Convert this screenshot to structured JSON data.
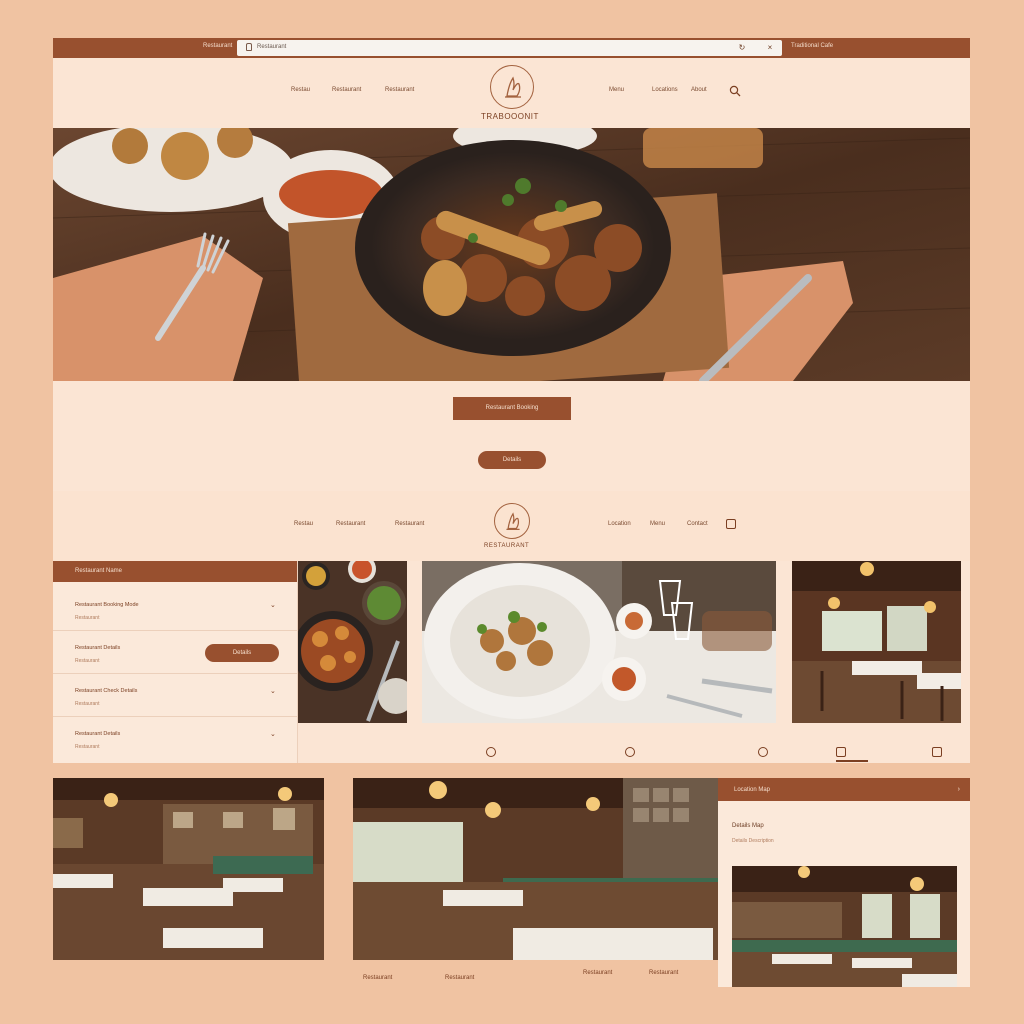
{
  "browser": {
    "left_label": "Restaurant",
    "url": "Restaurant",
    "right_label": "Traditional Cafe"
  },
  "header": {
    "nav_left": [
      "Restau",
      "Restaurant",
      "Restaurant"
    ],
    "nav_right": [
      "Menu",
      "Locations",
      "About"
    ],
    "brand": "TRABOOONIT"
  },
  "hero": {
    "reserve_label": "Restaurant Booking",
    "details_label": "Details"
  },
  "second_header": {
    "nav_left": [
      "Restau",
      "Restaurant",
      "Restaurant"
    ],
    "nav_right": [
      "Location",
      "Menu",
      "Contact"
    ],
    "brand": "RESTAURANT"
  },
  "filters": {
    "title": "Restaurant Name",
    "rows": [
      {
        "label": "Restaurant Booking Mode",
        "sub": "Restaurant"
      },
      {
        "label": "Restaurant Details",
        "sub": "Restaurant"
      },
      {
        "label": "Restaurant Check Details",
        "sub": "Restaurant"
      },
      {
        "label": "Restaurant Details",
        "sub": "Restaurant"
      }
    ],
    "see_more": "Details"
  },
  "bottom": {
    "captions": [
      "Restaurant",
      "Restaurant",
      "Restaurant",
      "Restaurant"
    ],
    "card_title": "Location Map",
    "card_subtitle": "Details Map",
    "card_text": "Details Description"
  },
  "icons": {
    "search": "search-icon",
    "lock": "lock-icon",
    "reload": "reload-icon",
    "chevron": "chevron-down-icon"
  },
  "colors": {
    "brand": "#98502f",
    "background": "#f0c3a2",
    "panel": "#fbe5d4"
  }
}
